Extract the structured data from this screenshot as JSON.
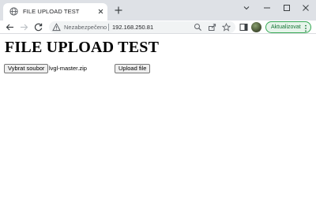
{
  "browser": {
    "tab": {
      "title": "FILE UPLOAD TEST",
      "favicon": "globe-icon"
    },
    "address_bar": {
      "security_label": "Nezabezpečeno",
      "url": "192.168.250.81"
    },
    "update_button": {
      "label": "Aktualizovat"
    },
    "colors": {
      "tabstrip": "#dee1e6",
      "update_border": "#34a853",
      "update_text": "#137333"
    }
  },
  "page": {
    "heading": "FILE UPLOAD TEST",
    "file_input": {
      "button_label": "Vybrat soubor",
      "selected_file": "lvgl-master.zip"
    },
    "upload_button": {
      "label": "Upload file"
    }
  }
}
